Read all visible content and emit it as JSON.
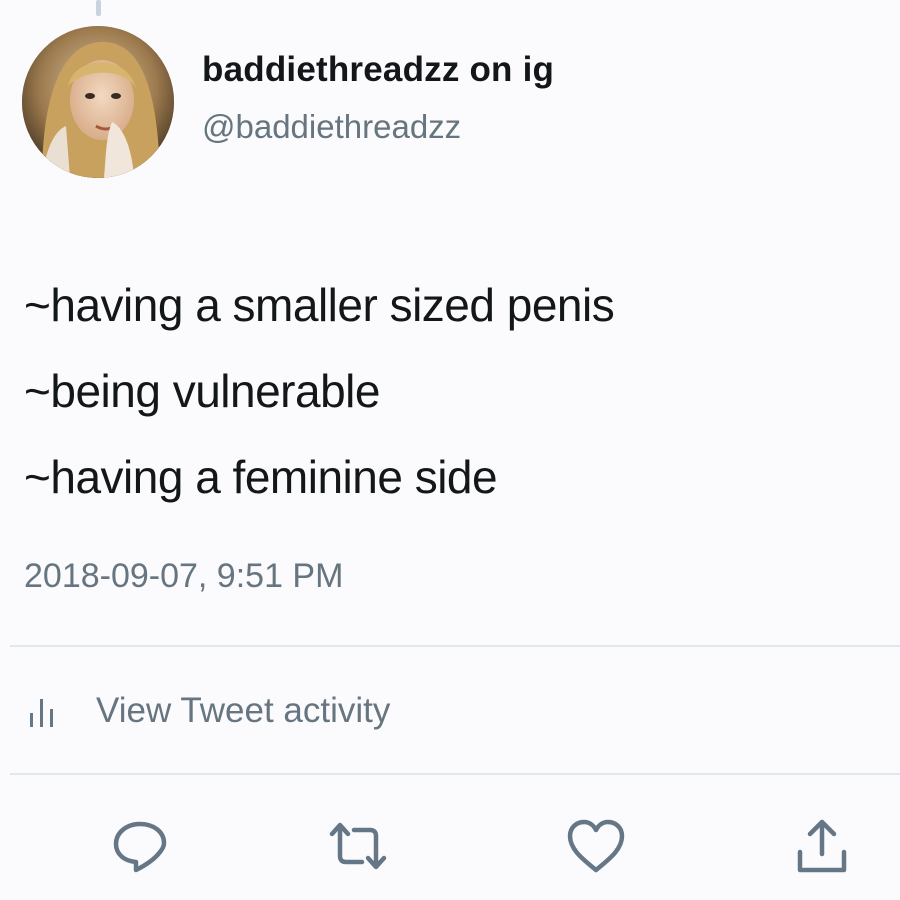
{
  "user": {
    "display_name": "baddiethreadzz on ig",
    "handle": "@baddiethreadzz",
    "avatar_icon": "profile-photo"
  },
  "tweet": {
    "lines": [
      "~having a smaller sized penis",
      "~being vulnerable",
      "~having a feminine side"
    ],
    "timestamp": "2018-09-07, 9:51 PM"
  },
  "activity": {
    "icon": "bar-chart-icon",
    "label": "View Tweet activity"
  },
  "actions": [
    {
      "name": "reply",
      "icon": "speech-bubble-icon"
    },
    {
      "name": "retweet",
      "icon": "retweet-arrows-icon"
    },
    {
      "name": "like",
      "icon": "heart-icon"
    },
    {
      "name": "share",
      "icon": "share-upload-icon"
    }
  ],
  "colors": {
    "text_primary": "#14171a",
    "text_secondary": "#66757f",
    "icon_gray": "#657786",
    "divider": "#e1e8ed"
  }
}
